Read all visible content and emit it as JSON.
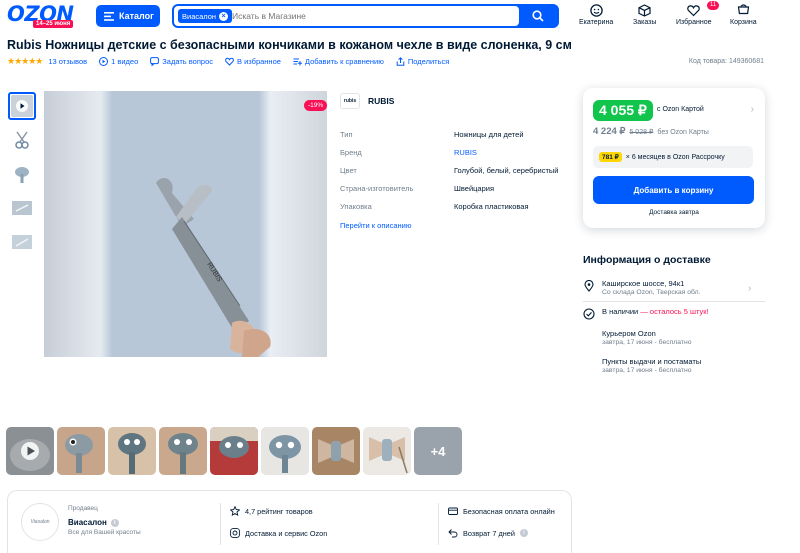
{
  "header": {
    "logo_text": "OZON",
    "logo_sub": "14–25 июня",
    "catalog_label": "Каталог",
    "search_chip": "Виасалон",
    "search_placeholder": "Искать в Магазине",
    "nav": [
      {
        "label": "Екатерина",
        "icon": "user-icon"
      },
      {
        "label": "Заказы",
        "icon": "box-icon"
      },
      {
        "label": "Избранное",
        "icon": "heart-icon",
        "badge": "11"
      },
      {
        "label": "Корзина",
        "icon": "cart-icon"
      }
    ]
  },
  "product": {
    "title": "Rubis Ножницы детские с безопасными кончиками в кожаном чехле в виде слоненка, 9 см",
    "stars": "★★★★★",
    "reviews": "13 отзывов",
    "video": "1 видео",
    "ask": "Задать вопрос",
    "favorite": "В избранное",
    "compare": "Добавить к сравнению",
    "share": "Поделиться",
    "sku": "Код товара: 149360681",
    "discount": "-19%"
  },
  "brand": {
    "logo": "rubis",
    "name": "RUBIS"
  },
  "specs": [
    {
      "key": "Тип",
      "value": "Ножницы для детей"
    },
    {
      "key": "Бренд",
      "value": "RUBIS",
      "link": true
    },
    {
      "key": "Цвет",
      "value": "Голубой, белый, серебристый"
    },
    {
      "key": "Страна-изготовитель",
      "value": "Швейцария"
    },
    {
      "key": "Упаковка",
      "value": "Коробка пластиковая"
    }
  ],
  "desc_link": "Перейти к описанию",
  "price": {
    "card_price": "4 055 ₽",
    "card_label": "c Ozon Картой",
    "regular_price": "4 224 ₽",
    "old_price": "5 028 ₽",
    "regular_label": "без Ozon Карты",
    "installment_amount": "781 ₽",
    "installment_text": "× 6 месяцев в Ozon Рассрочку",
    "cart_button": "Добавить в корзину",
    "delivery_date": "Доставка завтра"
  },
  "delivery": {
    "title": "Информация о доставке",
    "address": "Каширское шоссе, 94к1",
    "address_sub": "Со склада Ozon, Тверская обл.",
    "stock_prefix": "В наличии",
    "stock_suffix": " — осталось 5 штук!",
    "courier": "Курьером Ozon",
    "courier_sub": "завтра, 17 июня - бесплатно",
    "pickup": "Пункты выдачи и постаматы",
    "pickup_sub": "завтра, 17 июня - бесплатно"
  },
  "strip_more": "+4",
  "seller": {
    "avatar_text": "Viasalon",
    "label": "Продавец",
    "name": "Виасалон",
    "sub": "Все для Вашей красоты",
    "rating": "4,7 рейтинг товаров",
    "service": "Доставка и сервис Ozon",
    "payment": "Безопасная оплата онлайн",
    "return": "Возврат 7 дней"
  },
  "colors": {
    "accent": "#005bff",
    "sale": "#f91155",
    "green": "#10c44c"
  }
}
